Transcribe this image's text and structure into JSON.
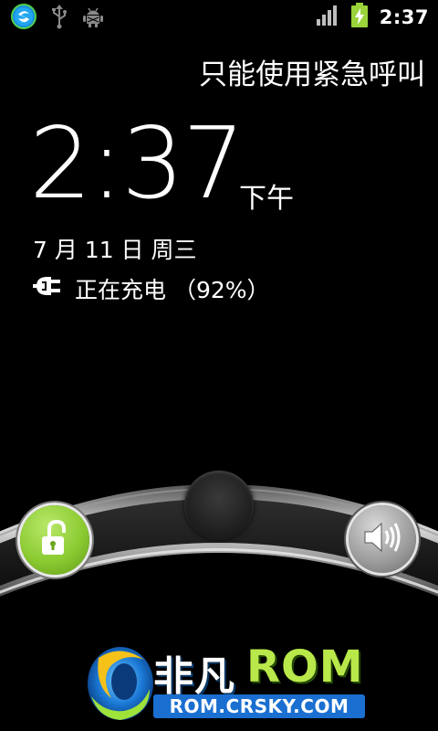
{
  "statusbar": {
    "time": "2:37",
    "left_icons": [
      "search-app-icon",
      "usb-icon",
      "android-debug-icon"
    ],
    "right_icons": [
      "signal-icon",
      "battery-charging-icon"
    ]
  },
  "lockscreen": {
    "emergency_text": "只能使用紧急呼叫",
    "time": "2:37",
    "ampm": "下午",
    "date": "7 月 11 日 周三",
    "charging_text": "正在充电 （92%）"
  },
  "unlock": {
    "left_icon": "unlock-icon",
    "right_icon": "sound-on-icon",
    "accent_green": "#8ccb32"
  },
  "watermark": {
    "brand_cn": "非凡",
    "brand_en": "ROM",
    "url": "ROM.CRSKY.COM"
  }
}
